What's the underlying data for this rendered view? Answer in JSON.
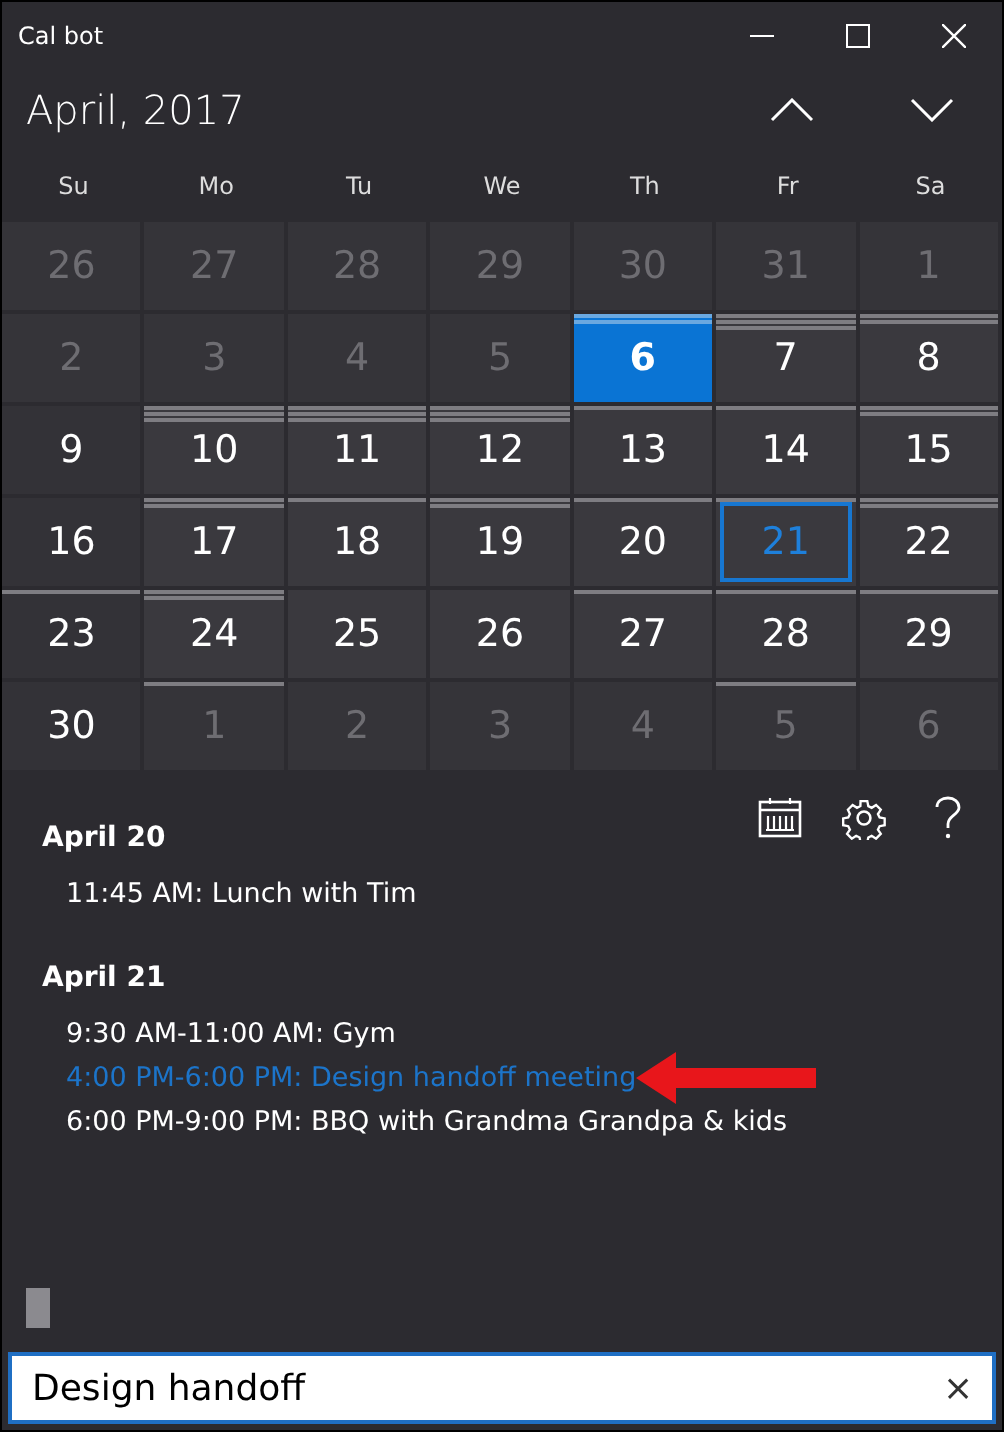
{
  "window": {
    "title": "Cal bot"
  },
  "header": {
    "month": "April, 2017"
  },
  "weekdays": [
    "Su",
    "Mo",
    "Tu",
    "We",
    "Th",
    "Fr",
    "Sa"
  ],
  "days": [
    {
      "day": "26",
      "in_month": false,
      "today": false,
      "focused": false
    },
    {
      "day": "27",
      "in_month": false,
      "today": false,
      "focused": false
    },
    {
      "day": "28",
      "in_month": false,
      "today": false,
      "focused": false
    },
    {
      "day": "29",
      "in_month": false,
      "today": false,
      "focused": false
    },
    {
      "day": "30",
      "in_month": false,
      "today": false,
      "focused": false
    },
    {
      "day": "31",
      "in_month": false,
      "today": false,
      "focused": false
    },
    {
      "day": "1",
      "in_month": false,
      "today": false,
      "focused": false
    },
    {
      "day": "2",
      "in_month": false,
      "today": false,
      "focused": false
    },
    {
      "day": "3",
      "in_month": false,
      "today": false,
      "focused": false
    },
    {
      "day": "4",
      "in_month": false,
      "today": false,
      "focused": false
    },
    {
      "day": "5",
      "in_month": false,
      "today": false,
      "focused": false
    },
    {
      "day": "6",
      "in_month": true,
      "today": true,
      "focused": false,
      "bars": [
        {
          "kind": "event"
        },
        {
          "kind": "event"
        }
      ]
    },
    {
      "day": "7",
      "in_month": true,
      "today": false,
      "focused": false,
      "bars": [
        {
          "kind": "event"
        },
        {
          "kind": "event"
        },
        {
          "kind": "event"
        }
      ]
    },
    {
      "day": "8",
      "in_month": true,
      "today": false,
      "focused": false,
      "bars": [
        {
          "kind": "event"
        },
        {
          "kind": "event"
        }
      ]
    },
    {
      "day": "9",
      "in_month": true,
      "today": false,
      "focused": false
    },
    {
      "day": "10",
      "in_month": true,
      "today": false,
      "focused": false,
      "bars": [
        {
          "kind": "event"
        },
        {
          "kind": "event"
        },
        {
          "kind": "event"
        }
      ]
    },
    {
      "day": "11",
      "in_month": true,
      "today": false,
      "focused": false,
      "bars": [
        {
          "kind": "event"
        },
        {
          "kind": "event"
        },
        {
          "kind": "event"
        }
      ]
    },
    {
      "day": "12",
      "in_month": true,
      "today": false,
      "focused": false,
      "bars": [
        {
          "kind": "event"
        },
        {
          "kind": "event"
        },
        {
          "kind": "event"
        }
      ]
    },
    {
      "day": "13",
      "in_month": true,
      "today": false,
      "focused": false,
      "bars": [
        {
          "kind": "event"
        }
      ]
    },
    {
      "day": "14",
      "in_month": true,
      "today": false,
      "focused": false,
      "bars": [
        {
          "kind": "event"
        }
      ]
    },
    {
      "day": "15",
      "in_month": true,
      "today": false,
      "focused": false,
      "bars": [
        {
          "kind": "event"
        },
        {
          "kind": "event"
        }
      ]
    },
    {
      "day": "16",
      "in_month": true,
      "today": false,
      "focused": false
    },
    {
      "day": "17",
      "in_month": true,
      "today": false,
      "focused": false,
      "bars": [
        {
          "kind": "event"
        },
        {
          "kind": "event"
        }
      ]
    },
    {
      "day": "18",
      "in_month": true,
      "today": false,
      "focused": false,
      "bars": [
        {
          "kind": "event"
        }
      ]
    },
    {
      "day": "19",
      "in_month": true,
      "today": false,
      "focused": false,
      "bars": [
        {
          "kind": "event"
        },
        {
          "kind": "event"
        }
      ]
    },
    {
      "day": "20",
      "in_month": true,
      "today": false,
      "focused": false,
      "bars": [
        {
          "kind": "event"
        }
      ]
    },
    {
      "day": "21",
      "in_month": true,
      "today": false,
      "focused": true,
      "bars": [
        {
          "kind": "event"
        }
      ]
    },
    {
      "day": "22",
      "in_month": true,
      "today": false,
      "focused": false,
      "bars": [
        {
          "kind": "event"
        },
        {
          "kind": "event"
        }
      ]
    },
    {
      "day": "23",
      "in_month": true,
      "today": false,
      "focused": false,
      "bars": [
        {
          "kind": "event"
        }
      ]
    },
    {
      "day": "24",
      "in_month": true,
      "today": false,
      "focused": false,
      "bars": [
        {
          "kind": "event"
        },
        {
          "kind": "event"
        }
      ]
    },
    {
      "day": "25",
      "in_month": true,
      "today": false,
      "focused": false
    },
    {
      "day": "26",
      "in_month": true,
      "today": false,
      "focused": false
    },
    {
      "day": "27",
      "in_month": true,
      "today": false,
      "focused": false,
      "bars": [
        {
          "kind": "event"
        }
      ]
    },
    {
      "day": "28",
      "in_month": true,
      "today": false,
      "focused": false,
      "bars": [
        {
          "kind": "event"
        }
      ]
    },
    {
      "day": "29",
      "in_month": true,
      "today": false,
      "focused": false,
      "bars": [
        {
          "kind": "event"
        }
      ]
    },
    {
      "day": "30",
      "in_month": true,
      "today": false,
      "focused": false
    },
    {
      "day": "1",
      "in_month": false,
      "today": false,
      "focused": false,
      "bars": [
        {
          "kind": "event"
        }
      ]
    },
    {
      "day": "2",
      "in_month": false,
      "today": false,
      "focused": false
    },
    {
      "day": "3",
      "in_month": false,
      "today": false,
      "focused": false
    },
    {
      "day": "4",
      "in_month": false,
      "today": false,
      "focused": false
    },
    {
      "day": "5",
      "in_month": false,
      "today": false,
      "focused": false,
      "bars": [
        {
          "kind": "event"
        }
      ]
    },
    {
      "day": "6",
      "in_month": false,
      "today": false,
      "focused": false
    }
  ],
  "agenda": [
    {
      "date": "April 20",
      "events": [
        {
          "text": "11:45 AM: Lunch with Tim",
          "highlighted": false
        }
      ]
    },
    {
      "date": "April 21",
      "events": [
        {
          "text": "9:30 AM-11:00 AM: Gym",
          "highlighted": false
        },
        {
          "text": "4:00 PM-6:00 PM: Design handoff meeting",
          "highlighted": true
        },
        {
          "text": "6:00 PM-9:00 PM: BBQ with Grandma Grandpa & kids",
          "highlighted": false
        }
      ]
    }
  ],
  "search": {
    "value": "Design handoff",
    "clear": "×"
  }
}
